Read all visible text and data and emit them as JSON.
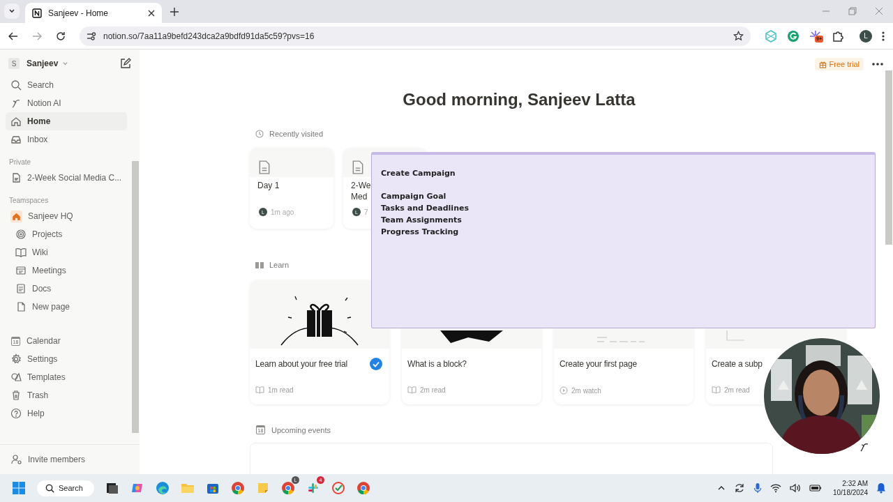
{
  "browser": {
    "tab": {
      "title": "Sanjeev - Home",
      "selected": true
    },
    "url": "notion.so/7aa11a9befd243dca2a9bdfd91da5c59?pvs=16",
    "extension_badge": "9+",
    "profile": "L"
  },
  "sidebar": {
    "workspace": {
      "initial": "S",
      "name": "Sanjeev"
    },
    "nav": [
      {
        "label": "Search",
        "selected": false
      },
      {
        "label": "Notion AI",
        "selected": false
      },
      {
        "label": "Home",
        "selected": true
      },
      {
        "label": "Inbox",
        "selected": false
      }
    ],
    "private": {
      "heading": "Private",
      "pages": [
        {
          "label": "2-Week Social Media C..."
        }
      ]
    },
    "teamspaces": {
      "heading": "Teamspaces",
      "items": [
        {
          "label": "Sanjeev HQ",
          "children": [
            {
              "label": "Projects"
            },
            {
              "label": "Wiki"
            },
            {
              "label": "Meetings"
            },
            {
              "label": "Docs"
            },
            {
              "label": "New page"
            }
          ]
        }
      ]
    },
    "bottom": [
      {
        "label": "Calendar",
        "icon_text": "18"
      },
      {
        "label": "Settings"
      },
      {
        "label": "Templates"
      },
      {
        "label": "Trash"
      },
      {
        "label": "Help"
      }
    ],
    "invite": "Invite members"
  },
  "header": {
    "trial": "Free trial"
  },
  "greeting": "Good morning, Sanjeev Latta",
  "recent": {
    "heading": "Recently visited",
    "cards": [
      {
        "title": [
          "Day 1"
        ],
        "avatar": "L",
        "time": "1m ago"
      },
      {
        "title": [
          "2-We",
          "Med"
        ],
        "avatar": "L",
        "time": "7"
      }
    ]
  },
  "learn": {
    "heading": "Learn",
    "cards": [
      {
        "title": "Learn about your free trial",
        "done": true,
        "kind": "read",
        "meta": "1m read"
      },
      {
        "title": "What is a block?",
        "done": false,
        "kind": "read",
        "meta": "2m read"
      },
      {
        "title": "Create your first page",
        "done": false,
        "kind": "watch",
        "meta": "2m watch"
      },
      {
        "title": "Create a subp",
        "done": false,
        "kind": "read",
        "meta": "2m read"
      }
    ]
  },
  "events": {
    "heading": "Upcoming events",
    "icon_text": "18"
  },
  "popup": {
    "title": "Create Campaign",
    "items": [
      "Campaign Goal",
      "Tasks and Deadlines",
      "Team Assignments",
      "Progress Tracking"
    ]
  },
  "taskbar": {
    "search": "Search",
    "chrome_badge": "L",
    "chat_badge": "4",
    "time": "2:32 AM",
    "date": "10/18/2024"
  }
}
